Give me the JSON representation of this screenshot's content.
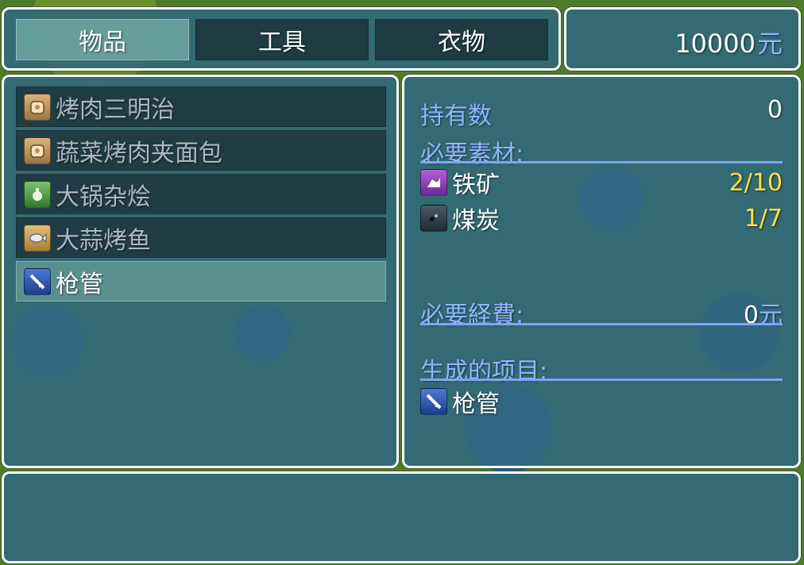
{
  "tabs": [
    {
      "label": "物品",
      "selected": true
    },
    {
      "label": "工具",
      "selected": false
    },
    {
      "label": "衣物",
      "selected": false
    }
  ],
  "gold": {
    "amount": "10000",
    "unit": "元"
  },
  "items": [
    {
      "label": "烤肉三明治",
      "icon": "sandwich-icon",
      "selected": false
    },
    {
      "label": "蔬菜烤肉夹面包",
      "icon": "bread-icon",
      "selected": false
    },
    {
      "label": "大锅杂烩",
      "icon": "stew-icon",
      "selected": false
    },
    {
      "label": "大蒜烤鱼",
      "icon": "fish-icon",
      "selected": false
    },
    {
      "label": "枪管",
      "icon": "gun-barrel-icon",
      "selected": true
    }
  ],
  "detail": {
    "owned_label": "持有数",
    "owned_value": "0",
    "materials_label": "必要素材:",
    "materials": [
      {
        "name": "铁矿",
        "icon": "iron-ore-icon",
        "count": "2/10"
      },
      {
        "name": "煤炭",
        "icon": "coal-icon",
        "count": "1/7"
      }
    ],
    "cost_label": "必要経費:",
    "cost_value": "0",
    "cost_unit": "元",
    "result_label": "生成的项目:",
    "result": {
      "name": "枪管",
      "icon": "gun-barrel-icon"
    }
  },
  "colors": {
    "window_bg": "#30687d",
    "label_blue": "#8fb6ff",
    "count_yellow": "#ffe23a"
  }
}
